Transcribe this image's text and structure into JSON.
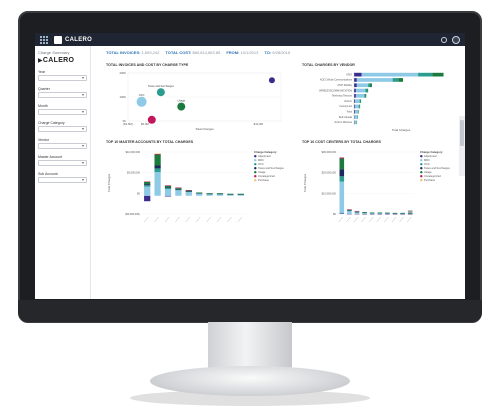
{
  "app": {
    "brand": "CALERO",
    "page_title": "Charge Summary",
    "sidebar_logo": "CALERO"
  },
  "filters": [
    {
      "label": "Year"
    },
    {
      "label": "Quarter"
    },
    {
      "label": "Month"
    },
    {
      "label": "Charge Category"
    },
    {
      "label": "Vendor"
    },
    {
      "label": "Master Account"
    },
    {
      "label": "Sub Account"
    }
  ],
  "kpis": [
    {
      "key": "TOTAL INVOICES:",
      "value": "1,659,242"
    },
    {
      "key": "TOTAL COST:",
      "value": "$80,814,853.85"
    },
    {
      "key": "FROM:",
      "value": "10/1/2013"
    },
    {
      "key": "TO:",
      "value": "9/28/2015"
    }
  ],
  "colors": {
    "accent": "#2a6fb5",
    "topbar": "#1f2533"
  },
  "chart_data": [
    {
      "type": "scatter",
      "title": "TOTAL INVOICES AND COST BY CHARGE TYPE",
      "xlabel": "Total Charges",
      "ylabel": "",
      "y_ticks": [
        "200K",
        "100K",
        "0K"
      ],
      "x_ticks": [
        "($1.5M)",
        "$0.0M",
        "$10.0M"
      ],
      "xlim": [
        -1.5,
        12
      ],
      "ylim": [
        0,
        200
      ],
      "points": [
        {
          "x": -0.3,
          "y": 80,
          "r": 5,
          "color": "#8ecae6",
          "label": "OCC"
        },
        {
          "x": 0.6,
          "y": 5,
          "r": 4,
          "color": "#c2185b",
          "label": ""
        },
        {
          "x": 1.4,
          "y": 120,
          "r": 4,
          "color": "#2a9d8f",
          "label": "Taxes and Surcharges"
        },
        {
          "x": 3.2,
          "y": 60,
          "r": 4,
          "color": "#1b7a3e",
          "label": "Usage"
        },
        {
          "x": 11.2,
          "y": 170,
          "r": 3,
          "color": "#3b2b8a",
          "label": ""
        }
      ]
    },
    {
      "type": "bar",
      "stacked": true,
      "orientation": "horizontal",
      "title": "TOTAL CHARGES BY VENDOR",
      "xlabel": "Total Charges",
      "categories": [
        "AT&T",
        "ACE Cellular Communications",
        "AT&T Mobility",
        "WIRELESSCOMMUNICATION",
        "Telefonica Telecom",
        "Verizon",
        "CenturyLink",
        "Telus",
        "Bell Canada",
        "Verizon Wireless"
      ],
      "series": [
        {
          "values": [
            0.8,
            0.3,
            0.3,
            0.2,
            0.2,
            0.1,
            0.1,
            0.1,
            0.05,
            0.05
          ],
          "color": "#3b2b8a"
        },
        {
          "values": [
            6.0,
            3.8,
            1.2,
            1.0,
            0.9,
            0.5,
            0.4,
            0.3,
            0.3,
            0.2
          ],
          "color": "#8ecae6"
        },
        {
          "values": [
            1.5,
            0.6,
            0.2,
            0.2,
            0.1,
            0.1,
            0.1,
            0.05,
            0.05,
            0.05
          ],
          "color": "#2a9d8f"
        },
        {
          "values": [
            1.2,
            0.5,
            0.2,
            0.1,
            0.1,
            0.05,
            0.05,
            0.05,
            0.02,
            0.02
          ],
          "color": "#1b7a3e"
        }
      ]
    },
    {
      "type": "bar",
      "stacked": true,
      "title": "TOP 10 MASTER ACCOUNTS BY TOTAL CHARGES",
      "ylabel": "Total Charges",
      "y_ticks": [
        "$10,000,000",
        "$5,000,000",
        "$0",
        "($5,000,000)"
      ],
      "ylim": [
        -5,
        12
      ],
      "categories": [
        "A1",
        "A2",
        "A3",
        "A4",
        "A5",
        "A6",
        "A7",
        "A8",
        "A9",
        "A10"
      ],
      "series": [
        {
          "name": "Adjustment",
          "values": [
            -1.5,
            0,
            -0.2,
            0,
            0,
            0,
            0,
            0,
            0,
            0
          ],
          "color": "#3b2b8a"
        },
        {
          "name": "MRC",
          "values": [
            2.5,
            6.5,
            1.8,
            1.5,
            1.0,
            0.6,
            0.4,
            0.4,
            0.3,
            0.3
          ],
          "color": "#8ecae6"
        },
        {
          "name": "OCC",
          "values": [
            0.4,
            1.0,
            0.3,
            0.2,
            0.2,
            0.1,
            0.1,
            0.1,
            0.1,
            0.1
          ],
          "color": "#2a9d8f"
        },
        {
          "name": "Taxes and Surcharges",
          "values": [
            0.3,
            0.8,
            0.2,
            0.2,
            0.1,
            0.1,
            0.1,
            0.1,
            0.05,
            0.05
          ],
          "color": "#1b2a5a"
        },
        {
          "name": "Usage",
          "values": [
            0.6,
            3.0,
            0.5,
            0.3,
            0.2,
            0.1,
            0.1,
            0.1,
            0.1,
            0.1
          ],
          "color": "#1b7a3e"
        },
        {
          "name": "Uncategorized",
          "values": [
            0.1,
            0.2,
            0.05,
            0.05,
            0.05,
            0,
            0,
            0,
            0,
            0
          ],
          "color": "#c2185b"
        },
        {
          "name": "Purchase",
          "values": [
            0,
            0.1,
            0,
            0,
            0,
            0,
            0,
            0,
            0,
            0
          ],
          "color": "#e9c46a"
        }
      ]
    },
    {
      "type": "bar",
      "stacked": true,
      "title": "TOP 10 COST CENTERS BY TOTAL CHARGES",
      "ylabel": "Total Charges",
      "y_ticks": [
        "$30,000,000",
        "$20,000,000",
        "$10,000,000",
        "$0"
      ],
      "ylim": [
        0,
        35
      ],
      "categories": [
        "C1",
        "C2",
        "C3",
        "C4",
        "C5",
        "C6",
        "C7",
        "C8",
        "C9",
        "C10"
      ],
      "series": [
        {
          "name": "Adjustment",
          "values": [
            0.3,
            0.1,
            0.1,
            0.05,
            0.05,
            0.05,
            0.05,
            0.05,
            0.05,
            0.05
          ],
          "color": "#3b2b8a"
        },
        {
          "name": "MRC",
          "values": [
            18,
            1.5,
            0.8,
            0.6,
            0.5,
            0.5,
            0.4,
            0.3,
            0.3,
            0.3
          ],
          "color": "#8ecae6"
        },
        {
          "name": "OCC",
          "values": [
            3,
            0.4,
            0.2,
            0.1,
            0.1,
            0.1,
            0.1,
            0.1,
            0.1,
            0.1
          ],
          "color": "#2a9d8f"
        },
        {
          "name": "Taxes and Surcharges",
          "values": [
            4,
            0.3,
            0.2,
            0.2,
            0.1,
            0.1,
            0.1,
            0.1,
            0.1,
            0.1
          ],
          "color": "#1b2a5a"
        },
        {
          "name": "Usage",
          "values": [
            6,
            0.2,
            0.2,
            0.1,
            0.1,
            0.1,
            0.1,
            0.1,
            0.1,
            0.1
          ],
          "color": "#1b7a3e"
        },
        {
          "name": "Uncategorized",
          "values": [
            0.5,
            0.1,
            0.05,
            0,
            0,
            0,
            0,
            0,
            0,
            0
          ],
          "color": "#c2185b"
        },
        {
          "name": "Purchase",
          "values": [
            0.3,
            0,
            0,
            0,
            0,
            0,
            0,
            0,
            0,
            1.4
          ],
          "color": "#9e9e9e"
        }
      ]
    }
  ],
  "legend": {
    "title": "Charge Category",
    "items": [
      {
        "name": "Adjustment",
        "color": "#3b2b8a"
      },
      {
        "name": "MRC",
        "color": "#8ecae6"
      },
      {
        "name": "OCC",
        "color": "#2a9d8f"
      },
      {
        "name": "Taxes and Surcharges",
        "color": "#1b2a5a"
      },
      {
        "name": "Usage",
        "color": "#1b7a3e"
      },
      {
        "name": "Uncategorized",
        "color": "#c2185b"
      },
      {
        "name": "Purchase",
        "color": "#e9c46a"
      }
    ]
  }
}
